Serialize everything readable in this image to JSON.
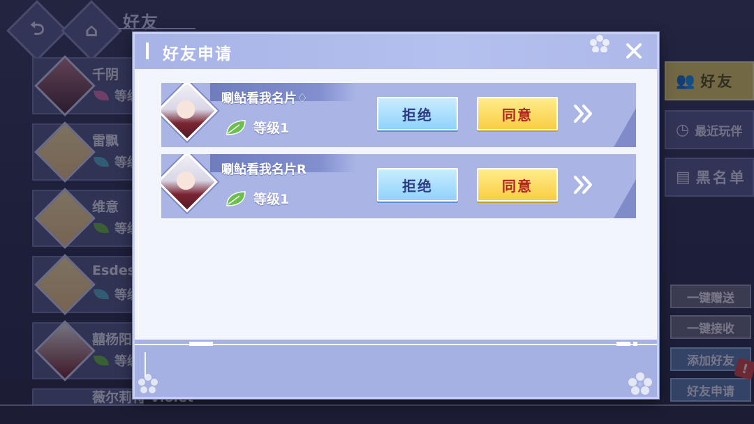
{
  "screen": {
    "title": "好友",
    "back_icon": "back-arrow-icon",
    "home_icon": "home-icon"
  },
  "friends": [
    {
      "name": "千阴",
      "level_prefix": "等级",
      "leaf_color": "#e07ab8"
    },
    {
      "name": "雷飘",
      "level_prefix": "等级",
      "leaf_color": "#5bb6d6"
    },
    {
      "name": "维意",
      "level_prefix": "等级",
      "leaf_color": "#6bbf4b"
    },
    {
      "name": "Esdes",
      "level_prefix": "等级",
      "leaf_color": "#5bb6d6"
    },
    {
      "name": "囍杨阳",
      "level_prefix": "等级",
      "leaf_color": "#6bbf4b"
    },
    {
      "name": "薇尔莉特 Violet",
      "level_prefix": "",
      "leaf_color": "#6bbf4b"
    }
  ],
  "right_tabs": [
    {
      "label": "好友",
      "icon": "friends-icon",
      "active": true
    },
    {
      "label": "最近玩伴",
      "icon": "recent-players-icon",
      "active": false
    },
    {
      "label": "黑名单",
      "icon": "blacklist-icon",
      "active": false
    }
  ],
  "side_buttons": {
    "gift_all": "一键赠送",
    "receive_all": "一键接收",
    "add_friend": "添加好友",
    "friend_requests": "好友申请",
    "alert_badge": "!"
  },
  "modal": {
    "title": "好友申请",
    "close_icon": "close-icon",
    "requests": [
      {
        "name": "唰鲇看我名片♢",
        "level": "等级1",
        "reject_label": "拒绝",
        "accept_label": "同意"
      },
      {
        "name": "唰鲇看我名片R",
        "level": "等级1",
        "reject_label": "拒绝",
        "accept_label": "同意"
      }
    ]
  },
  "colors": {
    "accent_accept": "#f9cd43",
    "accent_reject": "#8fd3fb",
    "accept_text": "#b4231f",
    "reject_text": "#2d3c84",
    "level_leaf": "#6bbf4b"
  }
}
